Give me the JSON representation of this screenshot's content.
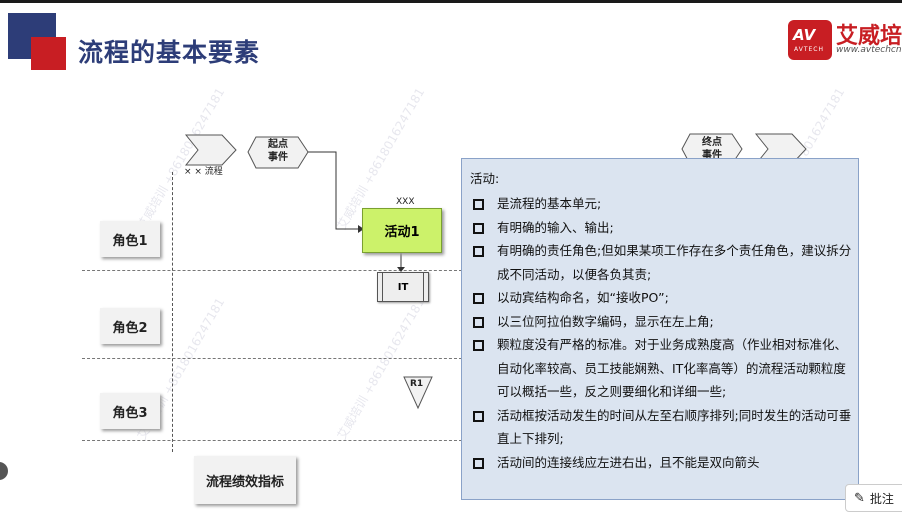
{
  "header": {
    "title": "流程的基本要素",
    "logo_av": "AV",
    "logo_tech": "AVTECH",
    "logo_cn": "艾威培",
    "logo_url": "www.avtechcn"
  },
  "flow": {
    "process_label": "× × 流程",
    "start_event": [
      "起点",
      "事件"
    ],
    "end_event": [
      "终点",
      "事件"
    ],
    "activity_code": "XXX",
    "activity_label": "活动1",
    "it_label": "IT",
    "risk_label": "R1"
  },
  "roles": [
    "角色1",
    "角色2",
    "角色3"
  ],
  "kpi_label": "流程绩效指标",
  "popup": {
    "title": "活动:",
    "items": [
      "是流程的基本单元;",
      "有明确的输入、输出;",
      "有明确的责任角色;但如果某项工作存在多个责任角色，建议拆分成不同活动，以便各负其责;",
      "以动宾结构命名，如“接收PO”;",
      "以三位阿拉伯数字编码，显示在左上角;",
      "颗粒度没有严格的标准。对于业务成熟度高（作业相对标准化、自动化率较高、员工技能娴熟、IT化率高等）的流程活动颗粒度可以概括一些，反之则要细化和详细一些;",
      "活动框按活动发生的时间从左至右顺序排列;同时发生的活动可垂直上下排列;",
      "活动间的连接线应左进右出，且不能是双向箭头"
    ]
  },
  "annotate_label": "批注",
  "watermark_text": "艾威培训 +8618016247181",
  "colors": {
    "title": "#2d3d78",
    "brand_red": "#c81e23",
    "activity_fill": "#ccf26a",
    "popup_fill": "#dbe4f0"
  }
}
